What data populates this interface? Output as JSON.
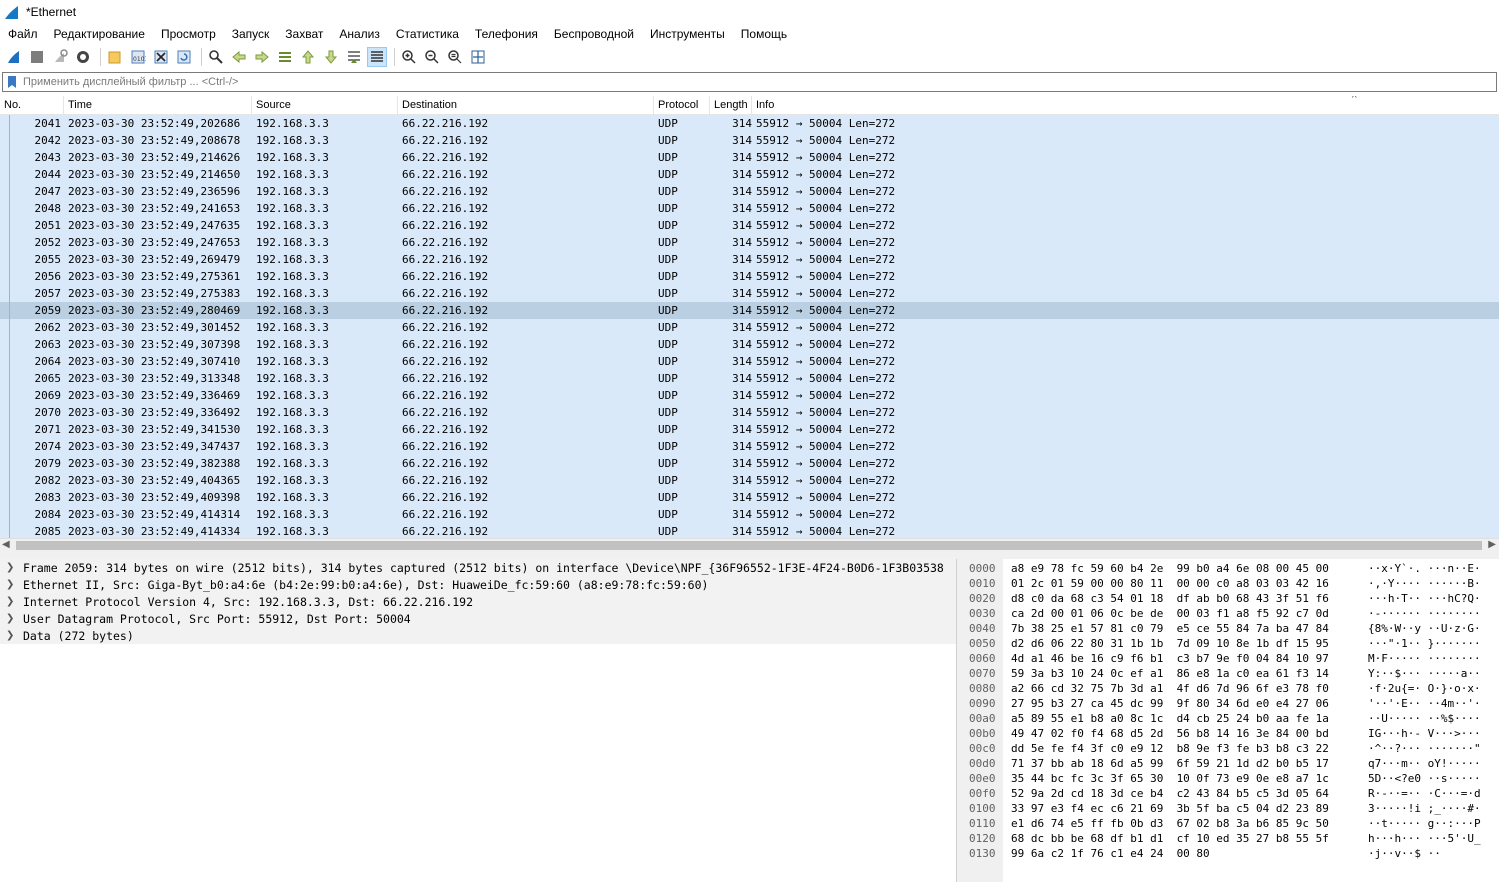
{
  "window": {
    "title": "*Ethernet"
  },
  "menu": [
    "Файл",
    "Редактирование",
    "Просмотр",
    "Запуск",
    "Захват",
    "Анализ",
    "Статистика",
    "Телефония",
    "Беспроводной",
    "Инструменты",
    "Помощь"
  ],
  "toolbar_icons": [
    "shark-fin-start-icon",
    "stop-capture-icon",
    "restart-capture-icon",
    "capture-options-icon",
    "open-file-icon",
    "save-file-icon",
    "close-file-icon",
    "reload-file-icon",
    "find-packet-icon",
    "go-back-icon",
    "go-forward-icon",
    "go-to-packet-icon",
    "first-packet-icon",
    "last-packet-icon",
    "auto-scroll-icon",
    "colorize-icon",
    "zoom-in-icon",
    "zoom-out-icon",
    "normal-size-icon",
    "resize-columns-icon"
  ],
  "filter": {
    "placeholder": "Применить дисплейный фильтр ... <Ctrl-/>"
  },
  "packet_list": {
    "columns": [
      "No.",
      "Time",
      "Source",
      "Destination",
      "Protocol",
      "Length",
      "Info"
    ],
    "rows": [
      {
        "no": "2041",
        "time": "2023-03-30 23:52:49,202686",
        "src": "192.168.3.3",
        "dst": "66.22.216.192",
        "proto": "UDP",
        "len": "314",
        "info": "55912 → 50004 Len=272"
      },
      {
        "no": "2042",
        "time": "2023-03-30 23:52:49,208678",
        "src": "192.168.3.3",
        "dst": "66.22.216.192",
        "proto": "UDP",
        "len": "314",
        "info": "55912 → 50004 Len=272"
      },
      {
        "no": "2043",
        "time": "2023-03-30 23:52:49,214626",
        "src": "192.168.3.3",
        "dst": "66.22.216.192",
        "proto": "UDP",
        "len": "314",
        "info": "55912 → 50004 Len=272"
      },
      {
        "no": "2044",
        "time": "2023-03-30 23:52:49,214650",
        "src": "192.168.3.3",
        "dst": "66.22.216.192",
        "proto": "UDP",
        "len": "314",
        "info": "55912 → 50004 Len=272"
      },
      {
        "no": "2047",
        "time": "2023-03-30 23:52:49,236596",
        "src": "192.168.3.3",
        "dst": "66.22.216.192",
        "proto": "UDP",
        "len": "314",
        "info": "55912 → 50004 Len=272"
      },
      {
        "no": "2048",
        "time": "2023-03-30 23:52:49,241653",
        "src": "192.168.3.3",
        "dst": "66.22.216.192",
        "proto": "UDP",
        "len": "314",
        "info": "55912 → 50004 Len=272"
      },
      {
        "no": "2051",
        "time": "2023-03-30 23:52:49,247635",
        "src": "192.168.3.3",
        "dst": "66.22.216.192",
        "proto": "UDP",
        "len": "314",
        "info": "55912 → 50004 Len=272"
      },
      {
        "no": "2052",
        "time": "2023-03-30 23:52:49,247653",
        "src": "192.168.3.3",
        "dst": "66.22.216.192",
        "proto": "UDP",
        "len": "314",
        "info": "55912 → 50004 Len=272"
      },
      {
        "no": "2055",
        "time": "2023-03-30 23:52:49,269479",
        "src": "192.168.3.3",
        "dst": "66.22.216.192",
        "proto": "UDP",
        "len": "314",
        "info": "55912 → 50004 Len=272"
      },
      {
        "no": "2056",
        "time": "2023-03-30 23:52:49,275361",
        "src": "192.168.3.3",
        "dst": "66.22.216.192",
        "proto": "UDP",
        "len": "314",
        "info": "55912 → 50004 Len=272"
      },
      {
        "no": "2057",
        "time": "2023-03-30 23:52:49,275383",
        "src": "192.168.3.3",
        "dst": "66.22.216.192",
        "proto": "UDP",
        "len": "314",
        "info": "55912 → 50004 Len=272"
      },
      {
        "no": "2059",
        "time": "2023-03-30 23:52:49,280469",
        "src": "192.168.3.3",
        "dst": "66.22.216.192",
        "proto": "UDP",
        "len": "314",
        "info": "55912 → 50004 Len=272",
        "selected": true
      },
      {
        "no": "2062",
        "time": "2023-03-30 23:52:49,301452",
        "src": "192.168.3.3",
        "dst": "66.22.216.192",
        "proto": "UDP",
        "len": "314",
        "info": "55912 → 50004 Len=272"
      },
      {
        "no": "2063",
        "time": "2023-03-30 23:52:49,307398",
        "src": "192.168.3.3",
        "dst": "66.22.216.192",
        "proto": "UDP",
        "len": "314",
        "info": "55912 → 50004 Len=272"
      },
      {
        "no": "2064",
        "time": "2023-03-30 23:52:49,307410",
        "src": "192.168.3.3",
        "dst": "66.22.216.192",
        "proto": "UDP",
        "len": "314",
        "info": "55912 → 50004 Len=272"
      },
      {
        "no": "2065",
        "time": "2023-03-30 23:52:49,313348",
        "src": "192.168.3.3",
        "dst": "66.22.216.192",
        "proto": "UDP",
        "len": "314",
        "info": "55912 → 50004 Len=272"
      },
      {
        "no": "2069",
        "time": "2023-03-30 23:52:49,336469",
        "src": "192.168.3.3",
        "dst": "66.22.216.192",
        "proto": "UDP",
        "len": "314",
        "info": "55912 → 50004 Len=272"
      },
      {
        "no": "2070",
        "time": "2023-03-30 23:52:49,336492",
        "src": "192.168.3.3",
        "dst": "66.22.216.192",
        "proto": "UDP",
        "len": "314",
        "info": "55912 → 50004 Len=272"
      },
      {
        "no": "2071",
        "time": "2023-03-30 23:52:49,341530",
        "src": "192.168.3.3",
        "dst": "66.22.216.192",
        "proto": "UDP",
        "len": "314",
        "info": "55912 → 50004 Len=272"
      },
      {
        "no": "2074",
        "time": "2023-03-30 23:52:49,347437",
        "src": "192.168.3.3",
        "dst": "66.22.216.192",
        "proto": "UDP",
        "len": "314",
        "info": "55912 → 50004 Len=272"
      },
      {
        "no": "2079",
        "time": "2023-03-30 23:52:49,382388",
        "src": "192.168.3.3",
        "dst": "66.22.216.192",
        "proto": "UDP",
        "len": "314",
        "info": "55912 → 50004 Len=272"
      },
      {
        "no": "2082",
        "time": "2023-03-30 23:52:49,404365",
        "src": "192.168.3.3",
        "dst": "66.22.216.192",
        "proto": "UDP",
        "len": "314",
        "info": "55912 → 50004 Len=272"
      },
      {
        "no": "2083",
        "time": "2023-03-30 23:52:49,409398",
        "src": "192.168.3.3",
        "dst": "66.22.216.192",
        "proto": "UDP",
        "len": "314",
        "info": "55912 → 50004 Len=272"
      },
      {
        "no": "2084",
        "time": "2023-03-30 23:52:49,414314",
        "src": "192.168.3.3",
        "dst": "66.22.216.192",
        "proto": "UDP",
        "len": "314",
        "info": "55912 → 50004 Len=272"
      },
      {
        "no": "2085",
        "time": "2023-03-30 23:52:49,414334",
        "src": "192.168.3.3",
        "dst": "66.22.216.192",
        "proto": "UDP",
        "len": "314",
        "info": "55912 → 50004 Len=272"
      }
    ]
  },
  "details": [
    "Frame 2059: 314 bytes on wire (2512 bits), 314 bytes captured (2512 bits) on interface \\Device\\NPF_{36F96552-1F3E-4F24-B0D6-1F3B03538",
    "Ethernet II, Src: Giga-Byt_b0:a4:6e (b4:2e:99:b0:a4:6e), Dst: HuaweiDe_fc:59:60 (a8:e9:78:fc:59:60)",
    "Internet Protocol Version 4, Src: 192.168.3.3, Dst: 66.22.216.192",
    "User Datagram Protocol, Src Port: 55912, Dst Port: 50004",
    "Data (272 bytes)"
  ],
  "hex_dump": [
    {
      "off": "0000",
      "bytes": "a8 e9 78 fc 59 60 b4 2e  99 b0 a4 6e 08 00 45 00",
      "ascii": "··x·Y`·. ···n··E·"
    },
    {
      "off": "0010",
      "bytes": "01 2c 01 59 00 00 80 11  00 00 c0 a8 03 03 42 16",
      "ascii": "·,·Y···· ······B·"
    },
    {
      "off": "0020",
      "bytes": "d8 c0 da 68 c3 54 01 18  df ab b0 68 43 3f 51 f6",
      "ascii": "···h·T·· ···hC?Q·"
    },
    {
      "off": "0030",
      "bytes": "ca 2d 00 01 06 0c be de  00 03 f1 a8 f5 92 c7 0d",
      "ascii": "·-······ ········"
    },
    {
      "off": "0040",
      "bytes": "7b 38 25 e1 57 81 c0 79  e5 ce 55 84 7a ba 47 84",
      "ascii": "{8%·W··y ··U·z·G·"
    },
    {
      "off": "0050",
      "bytes": "d2 d6 06 22 80 31 1b 1b  7d 09 10 8e 1b df 15 95",
      "ascii": "···\"·1·· }·······"
    },
    {
      "off": "0060",
      "bytes": "4d a1 46 be 16 c9 f6 b1  c3 b7 9e f0 04 84 10 97",
      "ascii": "M·F····· ········"
    },
    {
      "off": "0070",
      "bytes": "59 3a b3 10 24 0c ef a1  86 e8 1a c0 ea 61 f3 14",
      "ascii": "Y:··$··· ·····a··"
    },
    {
      "off": "0080",
      "bytes": "a2 66 cd 32 75 7b 3d a1  4f d6 7d 96 6f e3 78 f0",
      "ascii": "·f·2u{=· O·}·o·x·"
    },
    {
      "off": "0090",
      "bytes": "27 95 b3 27 ca 45 dc 99  9f 80 34 6d e0 e4 27 06",
      "ascii": "'··'·E·· ··4m··'·"
    },
    {
      "off": "00a0",
      "bytes": "a5 89 55 e1 b8 a0 8c 1c  d4 cb 25 24 b0 aa fe 1a",
      "ascii": "··U····· ··%$····"
    },
    {
      "off": "00b0",
      "bytes": "49 47 02 f0 f4 68 d5 2d  56 b8 14 16 3e 84 00 bd",
      "ascii": "IG···h·- V···>···"
    },
    {
      "off": "00c0",
      "bytes": "dd 5e fe f4 3f c0 e9 12  b8 9e f3 fe b3 b8 c3 22",
      "ascii": "·^··?··· ·······\""
    },
    {
      "off": "00d0",
      "bytes": "71 37 bb ab 18 6d a5 99  6f 59 21 1d d2 b0 b5 17",
      "ascii": "q7···m·· oY!·····"
    },
    {
      "off": "00e0",
      "bytes": "35 44 bc fc 3c 3f 65 30  10 0f 73 e9 0e e8 a7 1c",
      "ascii": "5D··<?e0 ··s·····"
    },
    {
      "off": "00f0",
      "bytes": "52 9a 2d cd 18 3d ce b4  c2 43 84 b5 c5 3d 05 64",
      "ascii": "R·-··=·· ·C···=·d"
    },
    {
      "off": "0100",
      "bytes": "33 97 e3 f4 ec c6 21 69  3b 5f ba c5 04 d2 23 89",
      "ascii": "3·····!i ;_····#·"
    },
    {
      "off": "0110",
      "bytes": "e1 d6 74 e5 ff fb 0b d3  67 02 b8 3a b6 85 9c 50",
      "ascii": "··t····· g··:···P"
    },
    {
      "off": "0120",
      "bytes": "68 dc bb be 68 df b1 d1  cf 10 ed 35 27 b8 55 5f",
      "ascii": "h···h··· ···5'·U_"
    },
    {
      "off": "0130",
      "bytes": "99 6a c2 1f 76 c1 e4 24  00 80",
      "ascii": "·j··v··$ ··"
    }
  ],
  "colors": {
    "row_bg": "#dae9f9",
    "row_selected": "#bacfe1",
    "accent": "#0c6ab0"
  }
}
